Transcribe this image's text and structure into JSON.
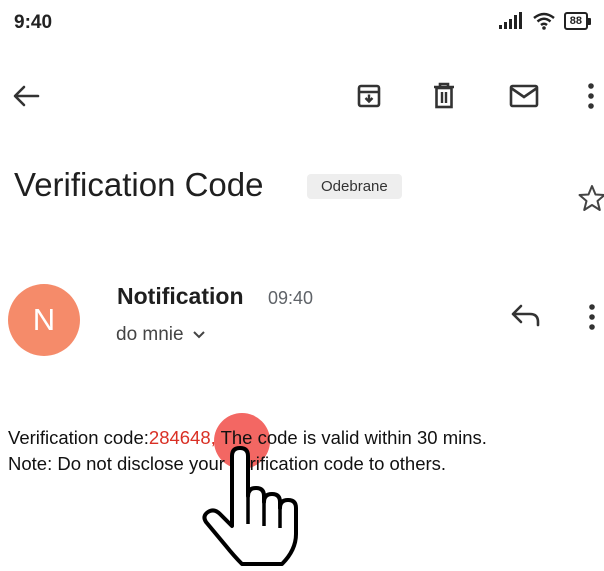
{
  "status_bar": {
    "time": "9:40",
    "battery": "88"
  },
  "toolbar": {
    "icons": [
      "back-arrow-icon",
      "archive-icon",
      "trash-icon",
      "mail-icon",
      "more-vert-icon"
    ]
  },
  "email": {
    "subject": "Verification Code",
    "label": "Odebrane",
    "sender_initial": "N",
    "sender_name": "Notification",
    "time": "09:40",
    "recipient": "do mnie",
    "body": {
      "line1_prefix": "Verification code:",
      "code": "284648,",
      "line1_suffix": " The code is valid within 30 mins.",
      "line2": "Note: Do not disclose your verification code to others."
    }
  },
  "colors": {
    "avatar": "#f58b6a",
    "code_highlight": "#d93025",
    "tap_indicator": "#f03c37"
  }
}
